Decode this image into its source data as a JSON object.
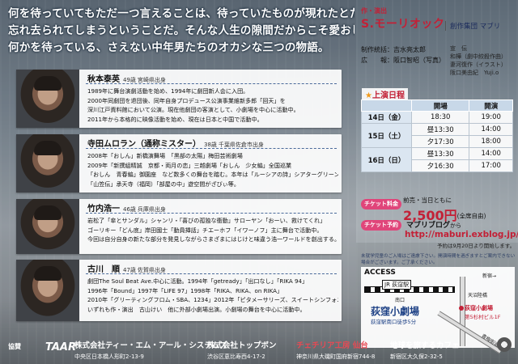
{
  "tagline": {
    "lines": [
      "何を待っていてもただ一つ言えることは、待っていたものが現れたとたんに待っていた時間は",
      "忘れ去られてしまうということだ。そんな人生の隙間だからこそ愛おしい。",
      "何かを待っている、さえない中年男たちのオカシな三つの物語。"
    ]
  },
  "credits": {
    "role": "作・演出",
    "director": "S.モーリオック",
    "troupe": "創作集団 マブリ",
    "staff_lines": [
      "制作統括：吉水亮太郎",
      "広　　報：阪口智昭（写真）"
    ],
    "staff_right": [
      "宣　伝",
      "和樺（劇中絞殺作曲）",
      "妻河復作（イラスト）",
      "阪口美由紀　Yuji.o"
    ]
  },
  "cast": [
    {
      "name": "秋本泰英",
      "age": "49歳",
      "pref": "宮崎県出身",
      "bio": [
        "1989年に舞台演劇活動を始め、1994年に劇団新人会に入団。",
        "2000年同劇団を退団後、同年自身プロデュース公演事業維新多郎「回天」を",
        "深川江戸資料館において公演。現在他劇団の客演として、小劇場を中心に活動中。",
        "2011年から本格的に映像活動を始め、現在は日本と中国で活動中。"
      ]
    },
    {
      "name": "寺田ムロラン（通称ミスター）",
      "age": "38歳",
      "pref": "千葉県佐倉市出身",
      "bio": [
        "2008年「おしん」新橋演舞場　「黒部の太陽」梅田芸術劇場",
        "2009年「新撰組精誠　京都・両月の恋」三越劇場「おしん　少女編」全国巡業",
        "「おしん　青春編」御園座　など数多くの舞台を踏む。本年は「ルーシアの詩」シアターグリーン",
        "「山笠伝」承天寺（福岡）「部屋の中」遊空間がざびぃ等。"
      ]
    },
    {
      "name": "竹内浩一",
      "age": "46歳",
      "pref": "兵庫県出身",
      "bio": [
        "岩松了「傘とサンダル」シャンリ・「喜びの孤独な衝動」サローヤン「おーい、救けてくれ」",
        "ゴーリキー「どん底」岸田國士「動員挿話」チエーホフ「イワーノフ」主に舞台で活動中。",
        "今回は自分自身の新たな部分を発見しながらさまざまにはじけと味違う浩一ワールドを創出する。"
      ]
    },
    {
      "name": "古川　順",
      "age": "47歳",
      "pref": "佐賀県出身",
      "bio": [
        "劇団The Soul Beat Ave.中心に活動。1994年「getready」「出口なし」「RIKA 94」",
        "1996年「Bound」1997年「LIFE 97」1998年「RIKA、RIKA、on RIKA」",
        "2010年「グリーティングフロム・SBA、1234」2012年「ピタメーサリーズ、スイートシンフォニー」",
        "いずれも作・演出　古山けい　他に外部小劇場出演。小劇場の舞台を中心に活動中。"
      ]
    }
  ],
  "schedule": {
    "title": "上演日程",
    "headers": [
      "",
      "開場",
      "開演"
    ],
    "rows": [
      {
        "day": "14日（金）",
        "open": "18:30",
        "start": "19:00"
      },
      {
        "day": "15日（土）",
        "open": "昼13:30",
        "start": "14:00"
      },
      {
        "day": "",
        "open": "夕17:30",
        "start": "18:00"
      },
      {
        "day": "16日（日）",
        "open": "昼13:30",
        "start": "14:00"
      },
      {
        "day": "",
        "open": "夕16:30",
        "start": "17:00"
      }
    ]
  },
  "tickets": {
    "fee_label": "チケット料金",
    "price_pre": "前売・当日ともに",
    "price": "2,500円",
    "price_note": "(全席自由)",
    "reserve_label": "チケット予約",
    "blog_title": "マブリブログ",
    "blog_suffix": "から",
    "url": "http://maburi.exblog.jp/",
    "url_note": "予約は9月20日より開始します。",
    "fine_print": "未就学児童のご入場はご遠慮下さい。開演時間を過ぎますとご案内できない場合がございます。ご了承ください。"
  },
  "access": {
    "title": "ACCESS",
    "station": "JR 荻窪駅",
    "labels": [
      "南口",
      "天沼陸橋",
      "青梅街道",
      "新宿→"
    ],
    "venue": "荻窪小劇場",
    "venue_dist": "荻窪駅南口徒歩5分",
    "venue_tag": "荻窪小劇場",
    "venue_addr": "第5杉村ビル1F"
  },
  "sponsors": {
    "label": "協賛",
    "logo_text": "TAAR",
    "items": [
      {
        "name": "株式会社ティー・エム・アール・システムズ",
        "addr": "中央区日本橋人形町2-13-9"
      },
      {
        "name": "株式会社トップボン",
        "addr": "渋谷区恵比寿西4-17-2"
      },
      {
        "name": "チェチリア工房 仙台",
        "addr": "神奈川県大磯町国府新宿744-8"
      },
      {
        "name": "地球を旅するカフェ",
        "addr": "新宿区大久保2-32-5"
      }
    ]
  },
  "colors": {
    "accent": "#c32036",
    "navy": "#1b3f84",
    "pill": "#e0457a"
  }
}
